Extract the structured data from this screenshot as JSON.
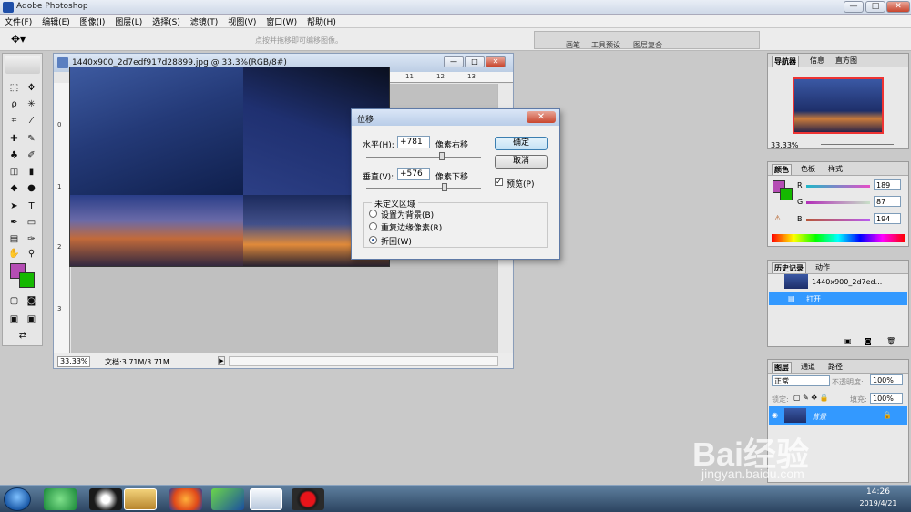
{
  "app": {
    "title": "Adobe Photoshop"
  },
  "window_buttons": {
    "minimize": "—",
    "maximize": "□",
    "close": "✕"
  },
  "menu": [
    "文件(F)",
    "编辑(E)",
    "图像(I)",
    "图层(L)",
    "选择(S)",
    "滤镜(T)",
    "视图(V)",
    "窗口(W)",
    "帮助(H)"
  ],
  "options_bar": {
    "tool_icon": "move-tool-icon",
    "hint": "点按并拖移即可编移图像。",
    "palette_well_tabs": [
      "画笔",
      "工具预设",
      "图层复合"
    ]
  },
  "document": {
    "title": "1440x900_2d7edf917d28899.jpg @ 33.3%(RGB/8#)",
    "zoom": "33.33%",
    "size": "文档:3.71M/3.71M",
    "ruler_top": [
      "0",
      "1",
      "2",
      "3",
      "4",
      "5",
      "6",
      "7",
      "8",
      "9",
      "10",
      "11",
      "12",
      "13"
    ],
    "ruler_left": [
      "0",
      "1",
      "2",
      "3"
    ]
  },
  "dialog": {
    "title": "位移",
    "horizontal_label": "水平(H):",
    "horizontal_value": "+781",
    "horizontal_unit": "像素右移",
    "vertical_label": "垂直(V):",
    "vertical_value": "+576",
    "vertical_unit": "像素下移",
    "ok_label": "确定",
    "cancel_label": "取消",
    "preview_label": "预览(P)",
    "preview_checked": true,
    "group_title": "未定义区域",
    "options": [
      "设置为背景(B)",
      "重复边缘像素(R)",
      "折回(W)"
    ],
    "selected_option": 2
  },
  "navigator": {
    "tabs": [
      "导航器",
      "信息",
      "直方图"
    ],
    "zoom": "33.33%"
  },
  "color_panel": {
    "tabs": [
      "颜色",
      "色板",
      "样式"
    ],
    "channels": [
      {
        "label": "R",
        "value": "189"
      },
      {
        "label": "G",
        "value": "87"
      },
      {
        "label": "B",
        "value": "194"
      }
    ],
    "foreground": "#b54db4",
    "background": "#15b800"
  },
  "history_panel": {
    "tabs": [
      "历史记录",
      "动作"
    ],
    "snapshot": "1440x900_2d7ed...",
    "items": [
      "打开"
    ]
  },
  "layers_panel": {
    "tabs": [
      "图层",
      "通道",
      "路径"
    ],
    "blend_mode": "正常",
    "opacity_label": "不透明度:",
    "opacity": "100%",
    "lock_label": "锁定:",
    "fill_label": "填充:",
    "fill": "100%",
    "layers": [
      "背景"
    ]
  },
  "taskbar": {
    "time": "14:26",
    "date": "2019/4/21",
    "apps": [
      "360-icon",
      "qq-icon",
      "explorer-icon",
      "firefox-icon",
      "media-icon",
      "photoshop-icon",
      "record-icon"
    ]
  },
  "watermark": {
    "brand": "Bai经验",
    "url": "jingyan.baidu.com"
  },
  "colors": {
    "selection": "#3399ff",
    "accent": "#3c7fb1"
  }
}
